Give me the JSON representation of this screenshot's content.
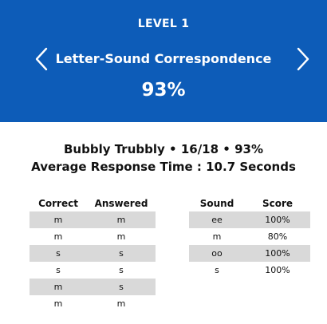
{
  "header": {
    "level": "LEVEL 1",
    "subject": "Letter-Sound Correspondence",
    "percent": "93%",
    "prev_icon": "chevron-left-icon",
    "next_icon": "chevron-right-icon",
    "background_color": "#0d5cb8"
  },
  "summary": {
    "line1": "Bubbly Trubbly • 16/18 • 93%",
    "line2": "Average Response Time : 10.7 Seconds"
  },
  "answers_table": {
    "headers": [
      "Correct",
      "Answered"
    ],
    "rows": [
      [
        "m",
        "m"
      ],
      [
        "m",
        "m"
      ],
      [
        "s",
        "s"
      ],
      [
        "s",
        "s"
      ],
      [
        "m",
        "s"
      ],
      [
        "m",
        "m"
      ]
    ]
  },
  "sounds_table": {
    "headers": [
      "Sound",
      "Score"
    ],
    "rows": [
      [
        "ee",
        "100%"
      ],
      [
        "m",
        "80%"
      ],
      [
        "oo",
        "100%"
      ],
      [
        "s",
        "100%"
      ]
    ]
  },
  "colors": {
    "accent": "#0d5cb8",
    "row_shade": "#d9d9d9"
  }
}
